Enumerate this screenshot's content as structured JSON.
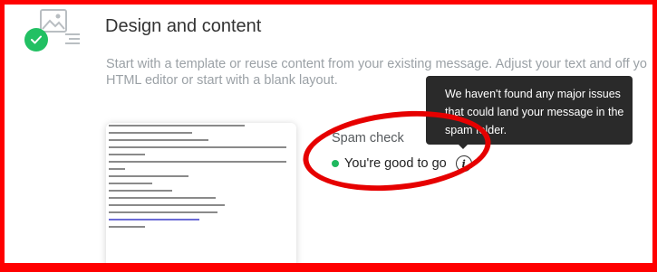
{
  "section": {
    "title": "Design and content",
    "description_line1": "Start with a template or reuse content from your existing message. Adjust your text and off yo",
    "description_line2": "HTML editor or start with a blank layout."
  },
  "spam_check": {
    "title": "Spam check",
    "status": "You're good to go",
    "tooltip": "We haven't found any major issues that could land your message in the spam folder."
  },
  "colors": {
    "annotation_red": "#ff0000",
    "success_green": "#22c063",
    "tooltip_bg": "#2a2a2a"
  },
  "icons": {
    "step_complete": "check-icon",
    "template": "image-icon",
    "text_lines": "lines-icon",
    "info": "info-icon"
  }
}
